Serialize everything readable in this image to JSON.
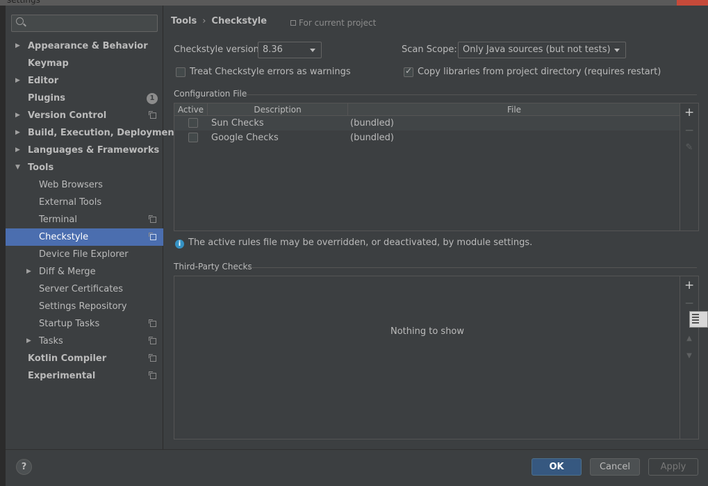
{
  "window": {
    "title": "settings"
  },
  "search": {
    "placeholder": ""
  },
  "sidebar": {
    "items": [
      {
        "label": "Appearance & Behavior"
      },
      {
        "label": "Keymap"
      },
      {
        "label": "Editor"
      },
      {
        "label": "Plugins",
        "badge": "1"
      },
      {
        "label": "Version Control"
      },
      {
        "label": "Build, Execution, Deployment"
      },
      {
        "label": "Languages & Frameworks"
      },
      {
        "label": "Tools"
      },
      {
        "label": "Web Browsers"
      },
      {
        "label": "External Tools"
      },
      {
        "label": "Terminal"
      },
      {
        "label": "Checkstyle"
      },
      {
        "label": "Device File Explorer"
      },
      {
        "label": "Diff & Merge"
      },
      {
        "label": "Server Certificates"
      },
      {
        "label": "Settings Repository"
      },
      {
        "label": "Startup Tasks"
      },
      {
        "label": "Tasks"
      },
      {
        "label": "Kotlin Compiler"
      },
      {
        "label": "Experimental"
      }
    ]
  },
  "breadcrumb": {
    "parent": "Tools",
    "current": "Checkstyle",
    "scope_note": "For current project"
  },
  "settings": {
    "version_label": "Checkstyle version:",
    "version_value": "8.36",
    "scan_scope_label": "Scan Scope:",
    "scan_scope_value": "Only Java sources (but not tests)",
    "treat_errors_label": "Treat Checkstyle errors as warnings",
    "treat_errors_checked": false,
    "copy_libs_label": "Copy libraries from project directory (requires restart)",
    "copy_libs_checked": true
  },
  "config_file": {
    "section_title": "Configuration File",
    "columns": [
      "Active",
      "Description",
      "File"
    ],
    "rows": [
      {
        "active": false,
        "description": "Sun Checks",
        "file": "(bundled)"
      },
      {
        "active": false,
        "description": "Google Checks",
        "file": "(bundled)"
      }
    ]
  },
  "info_message": "The active rules file may be overridden, or deactivated, by module settings.",
  "third_party": {
    "section_title": "Third-Party Checks",
    "empty_text": "Nothing to show"
  },
  "footer": {
    "help": "?",
    "ok": "OK",
    "cancel": "Cancel",
    "apply": "Apply"
  },
  "colors": {
    "background": "#3c3f41",
    "selection": "#4b6eaf",
    "ok_button": "#365880",
    "info_icon": "#3592c4"
  }
}
